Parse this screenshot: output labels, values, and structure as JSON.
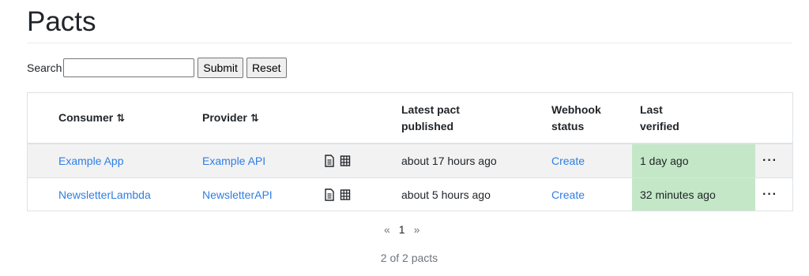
{
  "page": {
    "title": "Pacts"
  },
  "search": {
    "label": "Search",
    "value": "",
    "submit_label": "Submit",
    "reset_label": "Reset"
  },
  "table": {
    "headers": {
      "consumer": "Consumer",
      "provider": "Provider",
      "latest_line1": "Latest pact",
      "latest_line2": "published",
      "webhook_line1": "Webhook",
      "webhook_line2": "status",
      "verified_line1": "Last",
      "verified_line2": "verified",
      "sort_icon": "⇅"
    },
    "rows": [
      {
        "consumer": "Example App",
        "provider": "Example API",
        "latest_published": "about 17 hours ago",
        "webhook": "Create",
        "last_verified": "1 day ago",
        "more": "···"
      },
      {
        "consumer": "NewsletterLambda",
        "provider": "NewsletterAPI",
        "latest_published": "about 5 hours ago",
        "webhook": "Create",
        "last_verified": "32 minutes ago",
        "more": "···"
      }
    ]
  },
  "colors": {
    "link": "#2f7ee4",
    "verified_bg": "#c4e8c7",
    "stripe_bg": "#f2f2f2"
  },
  "icons": [
    "document-icon",
    "grid-icon",
    "sort-icon",
    "more-icon"
  ],
  "pagination": {
    "prev": "«",
    "current": "1",
    "next": "»"
  },
  "summary": {
    "count_text": "2 of 2 pacts"
  }
}
